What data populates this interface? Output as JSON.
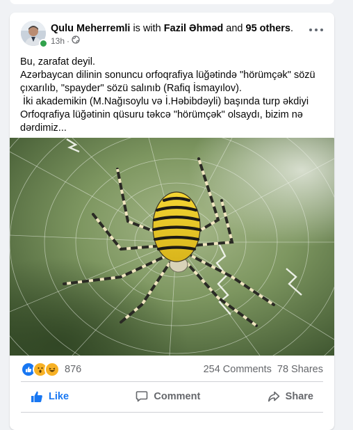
{
  "post": {
    "author": "Qulu Meherremli",
    "with_text": "is with",
    "tagged": "Fazil Əhməd",
    "and_text": "and",
    "others": "95 others",
    "time": "13h",
    "privacy_icon": "globe-icon",
    "text_lines": [
      "Bu, zarafat deyil.",
      "Azərbaycan dilinin sonuncu orfoqrafiya lüğətində \"hörümçək\" sözü",
      "çıxarılıb, \"spayder\" sözü salınıb (Rafiq İsmayılov).",
      " İki akademikin (M.Nağısoylu və İ.Həbibdəyli) başında turp əkdiyi",
      "Orfoqrafiya lüğətinin qüsuru təkcə \"hörümçək\" olsaydı, bizim nə",
      "dərdimiz..."
    ],
    "photo_subject": "spider on web"
  },
  "stats": {
    "reaction_icons": [
      "like-icon",
      "wow-icon",
      "haha-icon"
    ],
    "reaction_count": "876",
    "comments": "254 Comments",
    "shares": "78 Shares"
  },
  "actions": {
    "like": "Like",
    "comment": "Comment",
    "share": "Share"
  },
  "colors": {
    "like_blue": "#1877f2",
    "wow_yellow": "#f7b125",
    "online_green": "#31a24c"
  }
}
